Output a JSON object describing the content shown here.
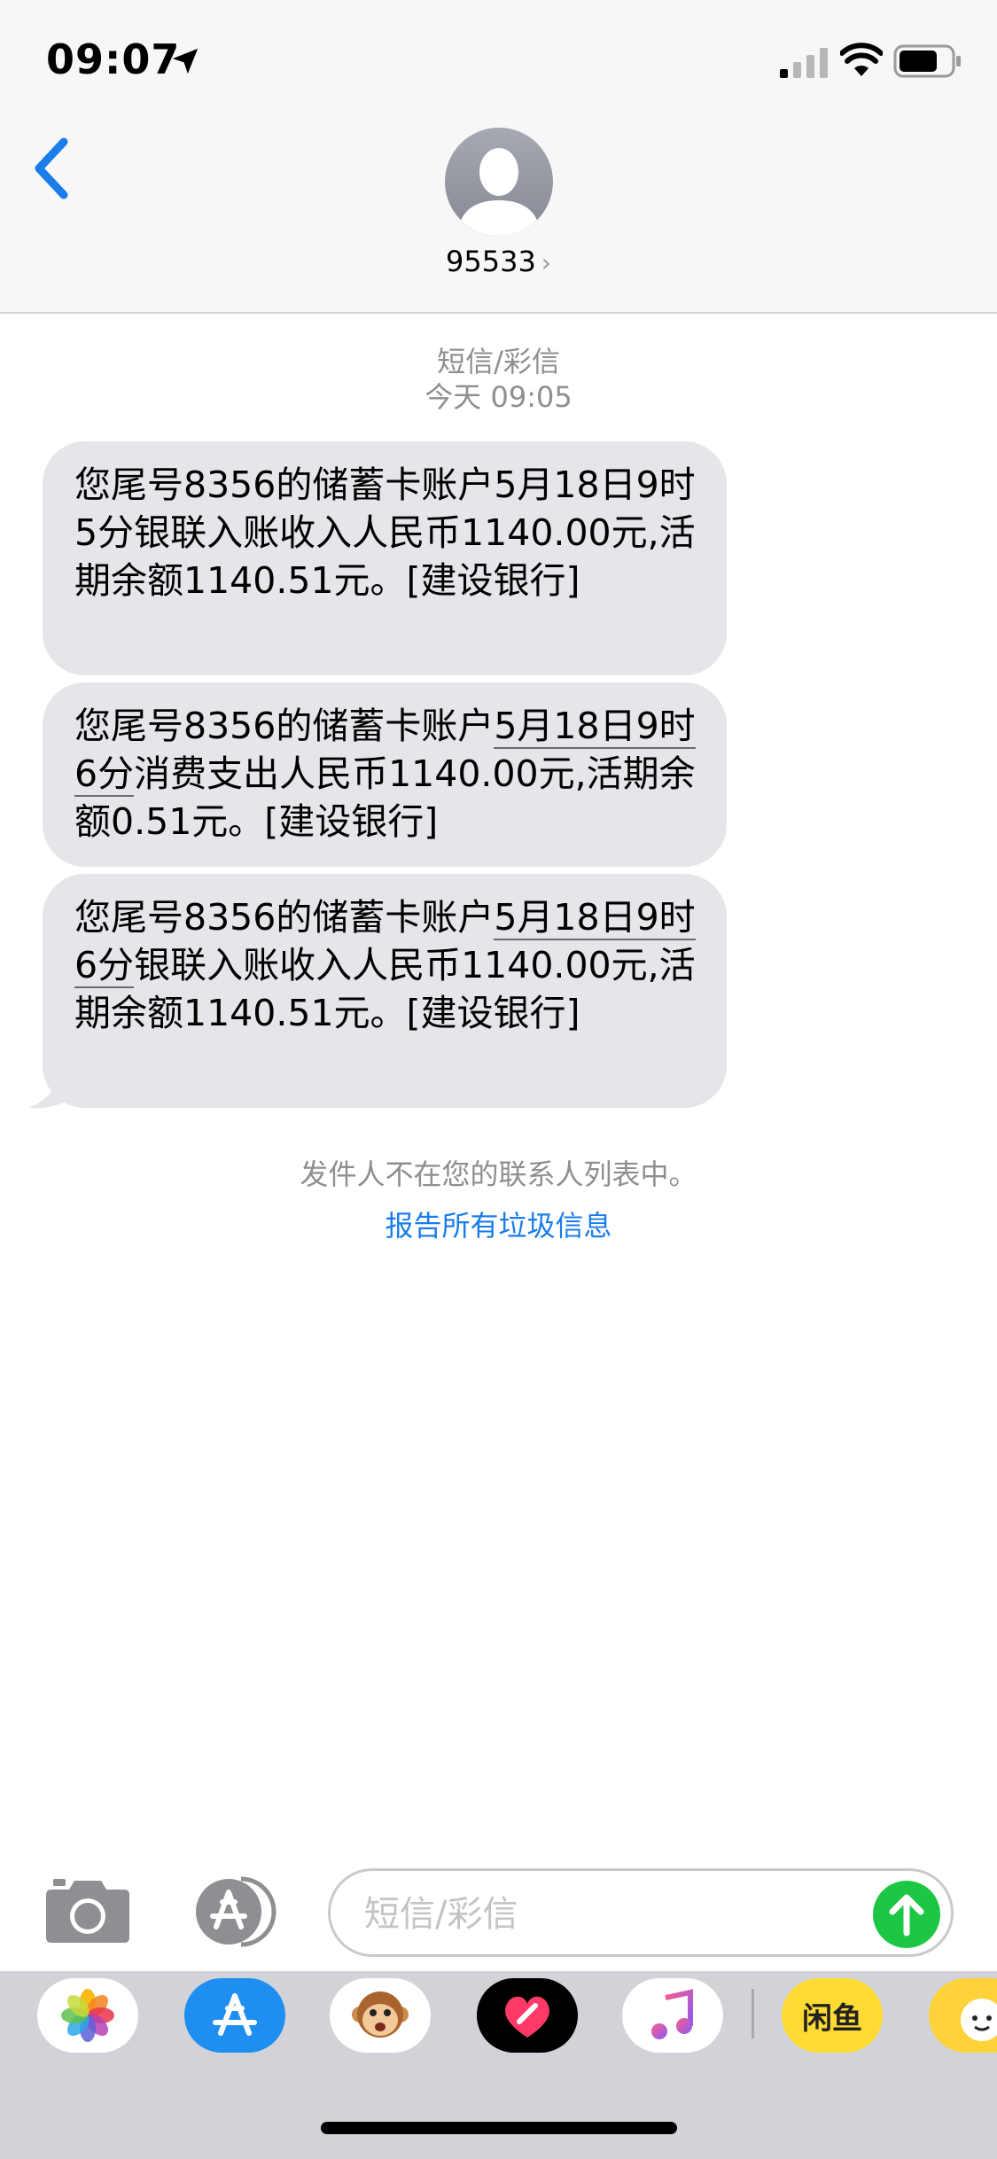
{
  "status": {
    "time": "09:07"
  },
  "header": {
    "contact": "95533",
    "chevron": "›"
  },
  "thread": {
    "type_label": "短信/彩信",
    "timestamp": "今天 09:05",
    "messages": [
      {
        "pre": "您尾号8356的储蓄卡账户5月18日9时5分银联入账收入人民币1140.00元,活期余额1140.51元。[建设银行]",
        "ul": "",
        "post": ""
      },
      {
        "pre": "您尾号8356的储蓄卡账户",
        "ul": "5月18日9时6分",
        "post": "消费支出人民币1140.00元,活期余额0.51元。[建设银行]"
      },
      {
        "pre": "您尾号8356的储蓄卡账户",
        "ul": "5月18日9时6分",
        "post": "银联入账收入人民币1140.00元,活期余额1140.51元。[建设银行]"
      }
    ],
    "notice": "发件人不在您的联系人列表中。",
    "report_link": "报告所有垃圾信息"
  },
  "composer": {
    "placeholder": "短信/彩信",
    "value": ""
  },
  "apps": {
    "items": [
      "photos-icon",
      "app-store-icon",
      "animoji-icon",
      "digital-touch-icon",
      "music-icon",
      "xianyu-icon",
      "partial-app-icon"
    ],
    "xianyu_label": "闲鱼"
  },
  "colors": {
    "accent": "#1a7dea",
    "bubble": "#e5e5ea",
    "send": "#1dc744"
  }
}
